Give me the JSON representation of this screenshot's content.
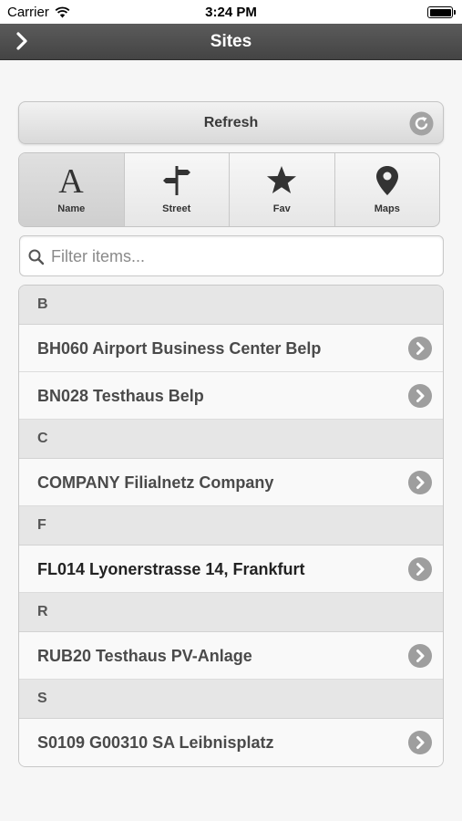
{
  "status_bar": {
    "carrier": "Carrier",
    "time": "3:24 PM",
    "wifi_icon": "wifi-icon",
    "battery_icon": "battery-icon"
  },
  "header": {
    "title": "Sites",
    "back_icon": "chevron-right-icon",
    "background": "#4f4f4f"
  },
  "refresh": {
    "label": "Refresh",
    "icon": "refresh-icon"
  },
  "tabs": [
    {
      "label": "Name",
      "icon": "letter-a-icon",
      "active": true
    },
    {
      "label": "Street",
      "icon": "signpost-icon",
      "active": false
    },
    {
      "label": "Fav",
      "icon": "star-icon",
      "active": false
    },
    {
      "label": "Maps",
      "icon": "map-pin-icon",
      "active": false
    }
  ],
  "search": {
    "placeholder": "Filter items...",
    "value": ""
  },
  "sites": {
    "sections": [
      {
        "letter": "B",
        "items": [
          "BH060 Airport Business Center Belp",
          "BN028 Testhaus Belp"
        ]
      },
      {
        "letter": "C",
        "items": [
          "COMPANY Filialnetz Company"
        ]
      },
      {
        "letter": "F",
        "items": [
          "FL014 Lyonerstrasse 14, Frankfurt"
        ]
      },
      {
        "letter": "R",
        "items": [
          "RUB20 Testhaus PV-Anlage"
        ]
      },
      {
        "letter": "S",
        "items": [
          "S0109 G00310 SA Leibnisplatz"
        ]
      }
    ]
  },
  "colors": {
    "accent_gray": "#9e9e9e",
    "header_bg": "#4f4f4f"
  }
}
